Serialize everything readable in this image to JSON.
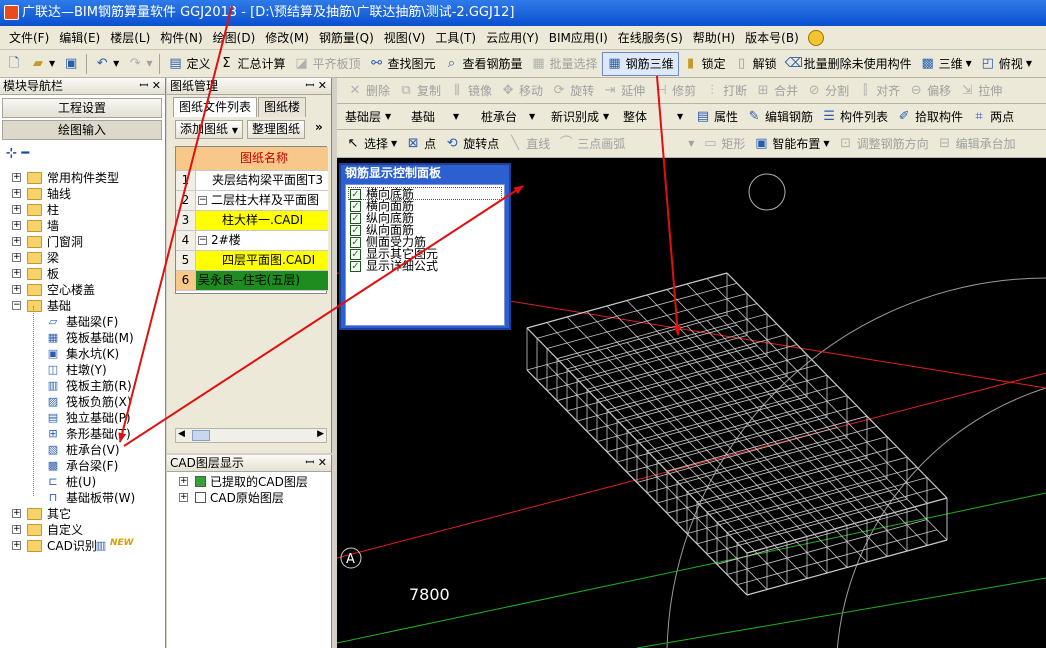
{
  "window": {
    "title": "广联达—BIM钢筋算量软件 GGJ2013 - [D:\\预结算及抽筋\\广联达抽筋\\测试-2.GGJ12]"
  },
  "menu": [
    "文件(F)",
    "编辑(E)",
    "楼层(L)",
    "构件(N)",
    "绘图(D)",
    "修改(M)",
    "钢筋量(Q)",
    "视图(V)",
    "工具(T)",
    "云应用(Y)",
    "BIM应用(I)",
    "在线服务(S)",
    "帮助(H)",
    "版本号(B)"
  ],
  "toolbar": {
    "define": "定义",
    "summary": "汇总计算",
    "flush_slab": "平齐板顶",
    "find_element": "查找图元",
    "view_rebar_qty": "查看钢筋量",
    "batch_select": "批量选择",
    "rebar_3d": "钢筋三维",
    "lock": "锁定",
    "unlock": "解锁",
    "batch_delete_unused": "批量删除未使用构件",
    "view_3d": "三维",
    "view_top": "俯视"
  },
  "edit_toolbar": [
    "删除",
    "复制",
    "镜像",
    "移动",
    "旋转",
    "延伸",
    "修剪",
    "打断",
    "合并",
    "分割",
    "对齐",
    "偏移",
    "拉伸"
  ],
  "selector_bar": {
    "floor": "基础层",
    "category": "基础",
    "element_type": "桩承台",
    "element_name": "新识别成",
    "scope": "整体",
    "properties": "属性",
    "edit_rebar": "编辑钢筋",
    "component_list": "构件列表",
    "pick_component": "拾取构件",
    "two_points": "两点"
  },
  "draw_toolbar": {
    "select": "选择",
    "point": "点",
    "rotate_point": "旋转点",
    "line": "直线",
    "three_point_arc": "三点画弧",
    "rectangle": "矩形",
    "smart_layout": "智能布置",
    "adjust_rebar_dir": "调整钢筋方向",
    "edit_cap_reinf": "编辑承台加"
  },
  "left_nav": {
    "title": "模块导航栏",
    "project_settings": "工程设置",
    "drawing_input": "绘图输入",
    "tree": [
      {
        "label": "常用构件类型",
        "level": 0,
        "expanded": false
      },
      {
        "label": "轴线",
        "level": 0,
        "expanded": false
      },
      {
        "label": "柱",
        "level": 0,
        "expanded": false
      },
      {
        "label": "墙",
        "level": 0,
        "expanded": false
      },
      {
        "label": "门窗洞",
        "level": 0,
        "expanded": false
      },
      {
        "label": "梁",
        "level": 0,
        "expanded": false
      },
      {
        "label": "板",
        "level": 0,
        "expanded": false
      },
      {
        "label": "空心楼盖",
        "level": 0,
        "expanded": false
      },
      {
        "label": "基础",
        "level": 0,
        "expanded": true
      },
      {
        "label": "基础梁(F)",
        "level": 1
      },
      {
        "label": "筏板基础(M)",
        "level": 1
      },
      {
        "label": "集水坑(K)",
        "level": 1
      },
      {
        "label": "柱墩(Y)",
        "level": 1
      },
      {
        "label": "筏板主筋(R)",
        "level": 1
      },
      {
        "label": "筏板负筋(X)",
        "level": 1
      },
      {
        "label": "独立基础(P)",
        "level": 1
      },
      {
        "label": "条形基础(T)",
        "level": 1
      },
      {
        "label": "桩承台(V)",
        "level": 1
      },
      {
        "label": "承台梁(F)",
        "level": 1
      },
      {
        "label": "桩(U)",
        "level": 1
      },
      {
        "label": "基础板带(W)",
        "level": 1
      },
      {
        "label": "其它",
        "level": 0,
        "expanded": false
      },
      {
        "label": "自定义",
        "level": 0,
        "expanded": false
      },
      {
        "label": "CAD识别",
        "level": 0,
        "expanded": false,
        "badge": "NEW"
      }
    ]
  },
  "drawing_panel": {
    "title": "图纸管理",
    "tabs": [
      "图纸文件列表",
      "图纸楼"
    ],
    "add_drawing": "添加图纸",
    "organize": "整理图纸",
    "column_header": "图纸名称",
    "rows": [
      {
        "num": "1",
        "name": "夹层结构梁平面图T3"
      },
      {
        "num": "2",
        "name": "二层柱大样及平面图"
      },
      {
        "num": "3",
        "name": "柱大样一.CADI"
      },
      {
        "num": "4",
        "name": "2#楼"
      },
      {
        "num": "5",
        "name": "四层平面图.CADI"
      },
      {
        "num": "6",
        "name": "吴永良--住宅(五层)"
      }
    ]
  },
  "cad_layer_panel": {
    "title": "CAD图层显示",
    "items": [
      "已提取的CAD图层",
      "CAD原始图层"
    ]
  },
  "control_panel": {
    "title": "钢筋显示控制面板",
    "items": [
      "横向底筋",
      "横向面筋",
      "纵向底筋",
      "纵向面筋",
      "侧面受力筋",
      "显示其它图元",
      "显示详细公式"
    ]
  },
  "viewport": {
    "axis_label": "A",
    "dimension": "7800"
  },
  "colors": {
    "title_bar": "#0a50d0",
    "highlight_row": "#ffff00",
    "selected_row": "#1e8c1e",
    "annotation_arrow": "#e01010",
    "wireframe": "#c8c8c8"
  }
}
